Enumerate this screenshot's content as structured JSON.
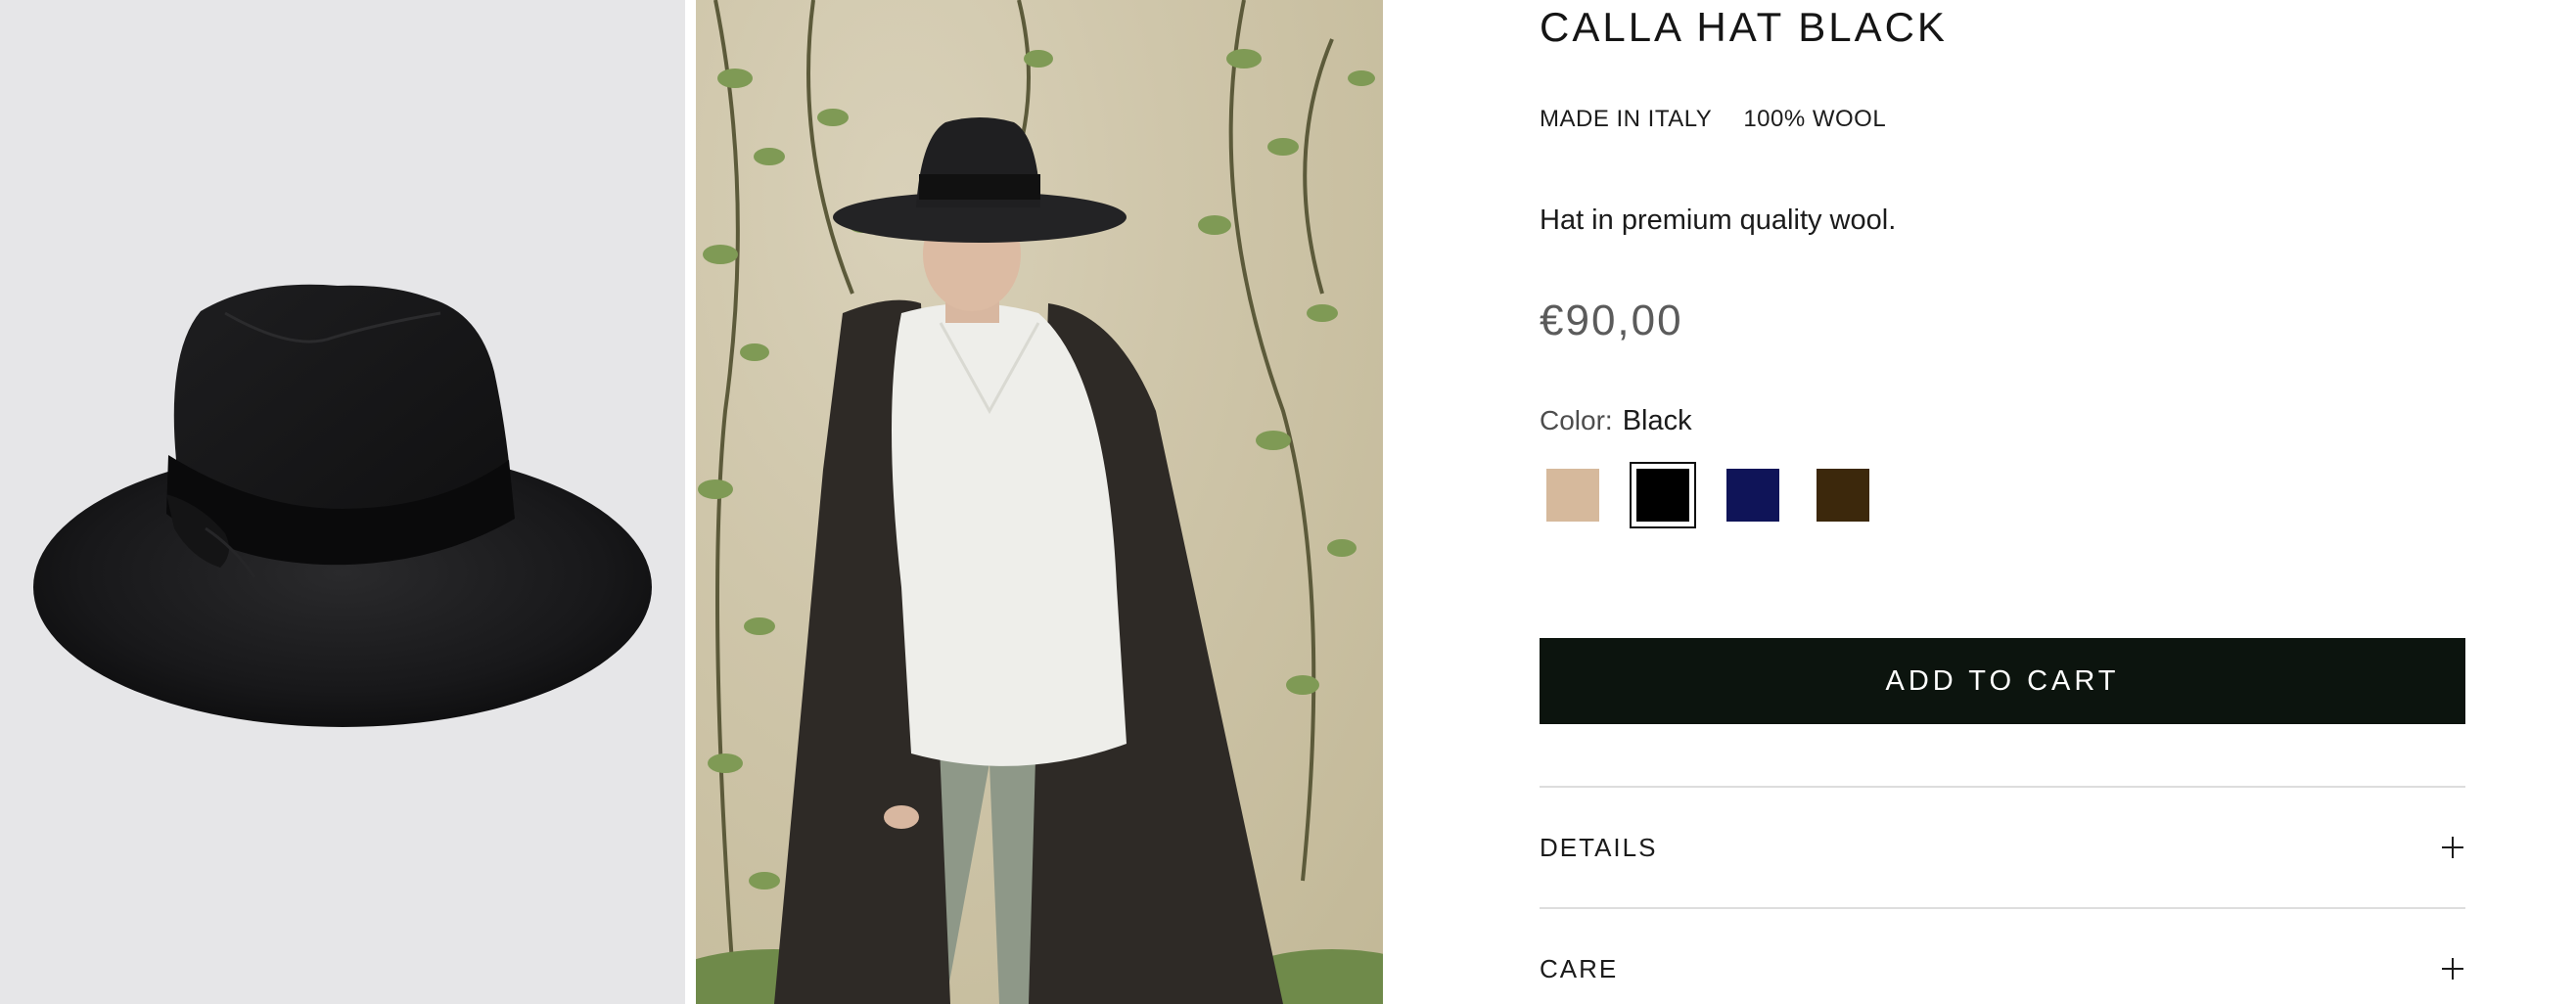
{
  "product": {
    "title": "CALLA HAT BLACK",
    "tags": [
      "MADE IN ITALY",
      "100% WOOL"
    ],
    "description": "Hat in premium quality wool.",
    "price": "€90,00",
    "color_label": "Color:",
    "color_value": "Black",
    "swatches": [
      {
        "name": "Beige",
        "color": "#d6b99c"
      },
      {
        "name": "Black",
        "color": "#000000"
      },
      {
        "name": "Navy",
        "color": "#0f1458"
      },
      {
        "name": "Brown",
        "color": "#3c280c"
      }
    ]
  },
  "actions": {
    "add_to_cart": "ADD TO CART"
  },
  "accordion": {
    "details_label": "DETAILS",
    "care_label": "CARE"
  },
  "colors": {
    "button_bg": "#0c140e",
    "gallery_bg": "#e6e6e8"
  },
  "icons": [
    "plus-icon"
  ]
}
